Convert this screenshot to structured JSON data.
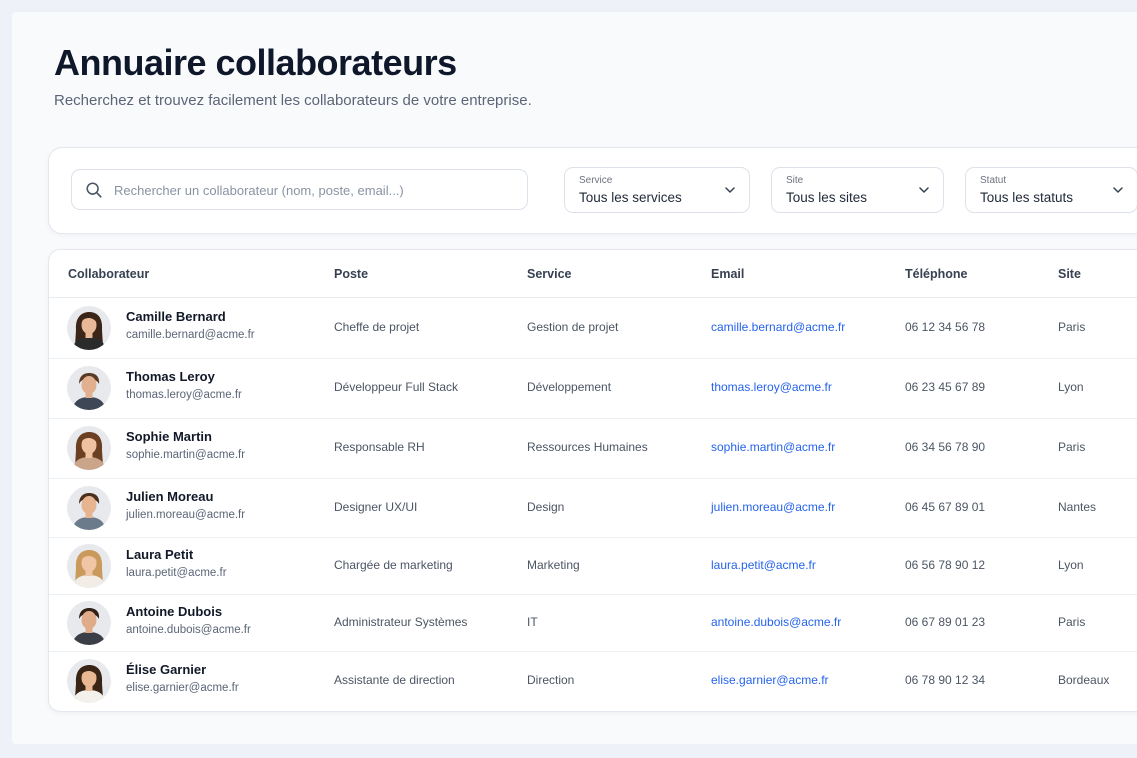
{
  "header": {
    "title": "Annuaire collaborateurs",
    "subtitle": "Recherchez et trouvez facilement les collaborateurs de votre entreprise."
  },
  "search": {
    "placeholder": "Rechercher un collaborateur (nom, poste, email...)",
    "value": ""
  },
  "filters": [
    {
      "label": "Service",
      "value": "Tous les services"
    },
    {
      "label": "Site",
      "value": "Tous les sites"
    },
    {
      "label": "Statut",
      "value": "Tous les statuts"
    }
  ],
  "table": {
    "columns": [
      "Collaborateur",
      "Poste",
      "Service",
      "Email",
      "Téléphone",
      "Site"
    ],
    "rows": [
      {
        "name": "Camille Bernard",
        "email": "camille.bernard@acme.fr",
        "poste": "Cheffe de projet",
        "service": "Gestion de projet",
        "phone": "06 12 34 56 78",
        "site": "Paris",
        "avatar": {
          "skin": "#e9b896",
          "hair": "#3b2418",
          "shirt": "#2b2b2b",
          "gender": "f"
        }
      },
      {
        "name": "Thomas Leroy",
        "email": "thomas.leroy@acme.fr",
        "poste": "Développeur Full Stack",
        "service": "Développement",
        "phone": "06 23 45 67 89",
        "site": "Lyon",
        "avatar": {
          "skin": "#e3b08f",
          "hair": "#5a3b26",
          "shirt": "#3d4756",
          "gender": "m"
        }
      },
      {
        "name": "Sophie Martin",
        "email": "sophie.martin@acme.fr",
        "poste": "Responsable RH",
        "service": "Ressources Humaines",
        "phone": "06 34 56 78 90",
        "site": "Paris",
        "avatar": {
          "skin": "#efc2a2",
          "hair": "#6b3f22",
          "shirt": "#caa58a",
          "gender": "f"
        }
      },
      {
        "name": "Julien Moreau",
        "email": "julien.moreau@acme.fr",
        "poste": "Designer UX/UI",
        "service": "Design",
        "phone": "06 45 67 89 01",
        "site": "Nantes",
        "avatar": {
          "skin": "#e6b48f",
          "hair": "#4a2f1d",
          "shirt": "#6b7b8c",
          "gender": "m"
        }
      },
      {
        "name": "Laura Petit",
        "email": "laura.petit@acme.fr",
        "poste": "Chargée de marketing",
        "service": "Marketing",
        "phone": "06 56 78 90 12",
        "site": "Lyon",
        "avatar": {
          "skin": "#f0c6a6",
          "hair": "#c99a5b",
          "shirt": "#f1ece6",
          "gender": "f"
        }
      },
      {
        "name": "Antoine Dubois",
        "email": "antoine.dubois@acme.fr",
        "poste": "Administrateur Systèmes",
        "service": "IT",
        "phone": "06 67 89 01 23",
        "site": "Paris",
        "avatar": {
          "skin": "#e0ab88",
          "hair": "#2f2117",
          "shirt": "#3a3f47",
          "gender": "m"
        }
      },
      {
        "name": "Élise Garnier",
        "email": "elise.garnier@acme.fr",
        "poste": "Assistante de direction",
        "service": "Direction",
        "phone": "06 78 90 12 34",
        "site": "Bordeaux",
        "avatar": {
          "skin": "#eab793",
          "hair": "#3a2416",
          "shirt": "#f4f1ec",
          "gender": "f"
        }
      }
    ]
  },
  "colors": {
    "accent_link": "#2563eb",
    "title": "#0f172a",
    "background": "#eef2f8"
  },
  "icons": [
    "search-icon",
    "chevron-down-icon"
  ]
}
